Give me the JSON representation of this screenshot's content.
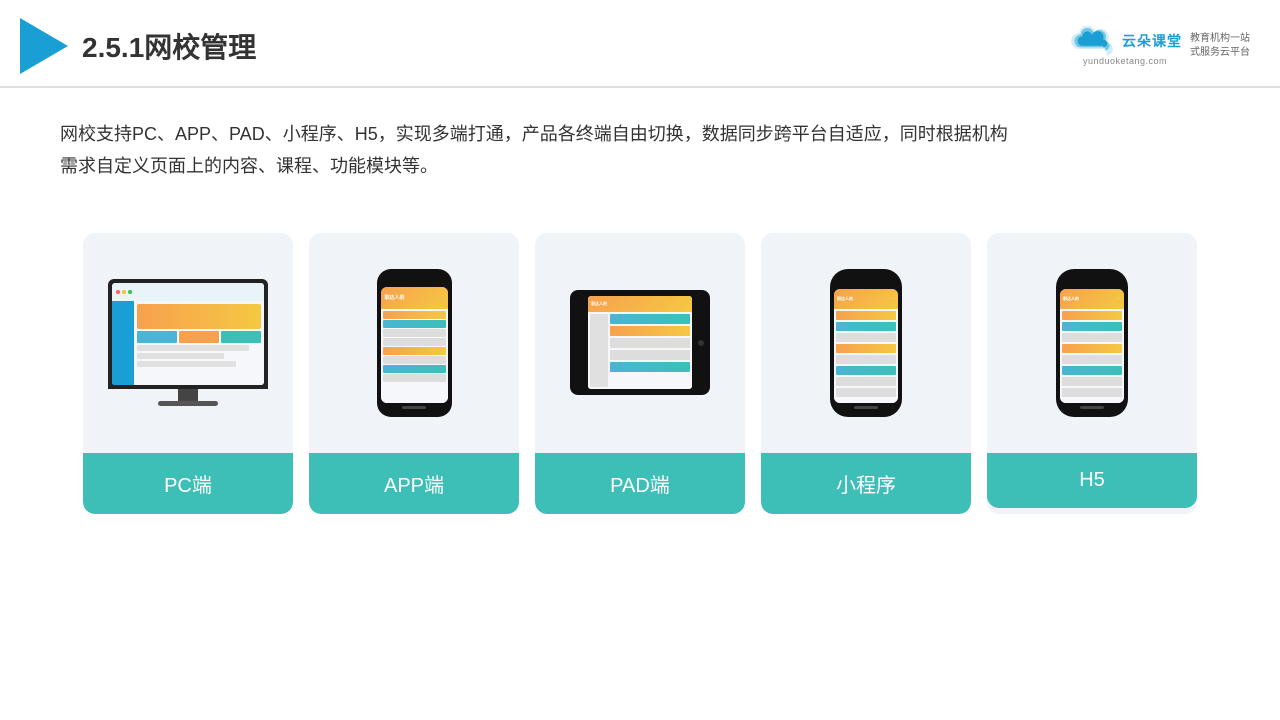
{
  "header": {
    "title": "2.5.1网校管理",
    "brand_name_cn": "云朵课堂",
    "brand_name_en": "yunduoketang.com",
    "brand_tagline_line1": "教育机构一站",
    "brand_tagline_line2": "式服务云平台"
  },
  "description": {
    "text": "网校支持PC、APP、PAD、小程序、H5，实现多端打通，产品各终端自由切换，数据同步跨平台自适应，同时根据机构需求自定义页面上的内容、课程、功能模块等。"
  },
  "cards": [
    {
      "id": "pc",
      "label": "PC端"
    },
    {
      "id": "app",
      "label": "APP端"
    },
    {
      "id": "pad",
      "label": "PAD端"
    },
    {
      "id": "miniprogram",
      "label": "小程序"
    },
    {
      "id": "h5",
      "label": "H5"
    }
  ],
  "colors": {
    "accent": "#3dbfb8",
    "blue": "#1a9fd4",
    "orange": "#f7a14e"
  }
}
